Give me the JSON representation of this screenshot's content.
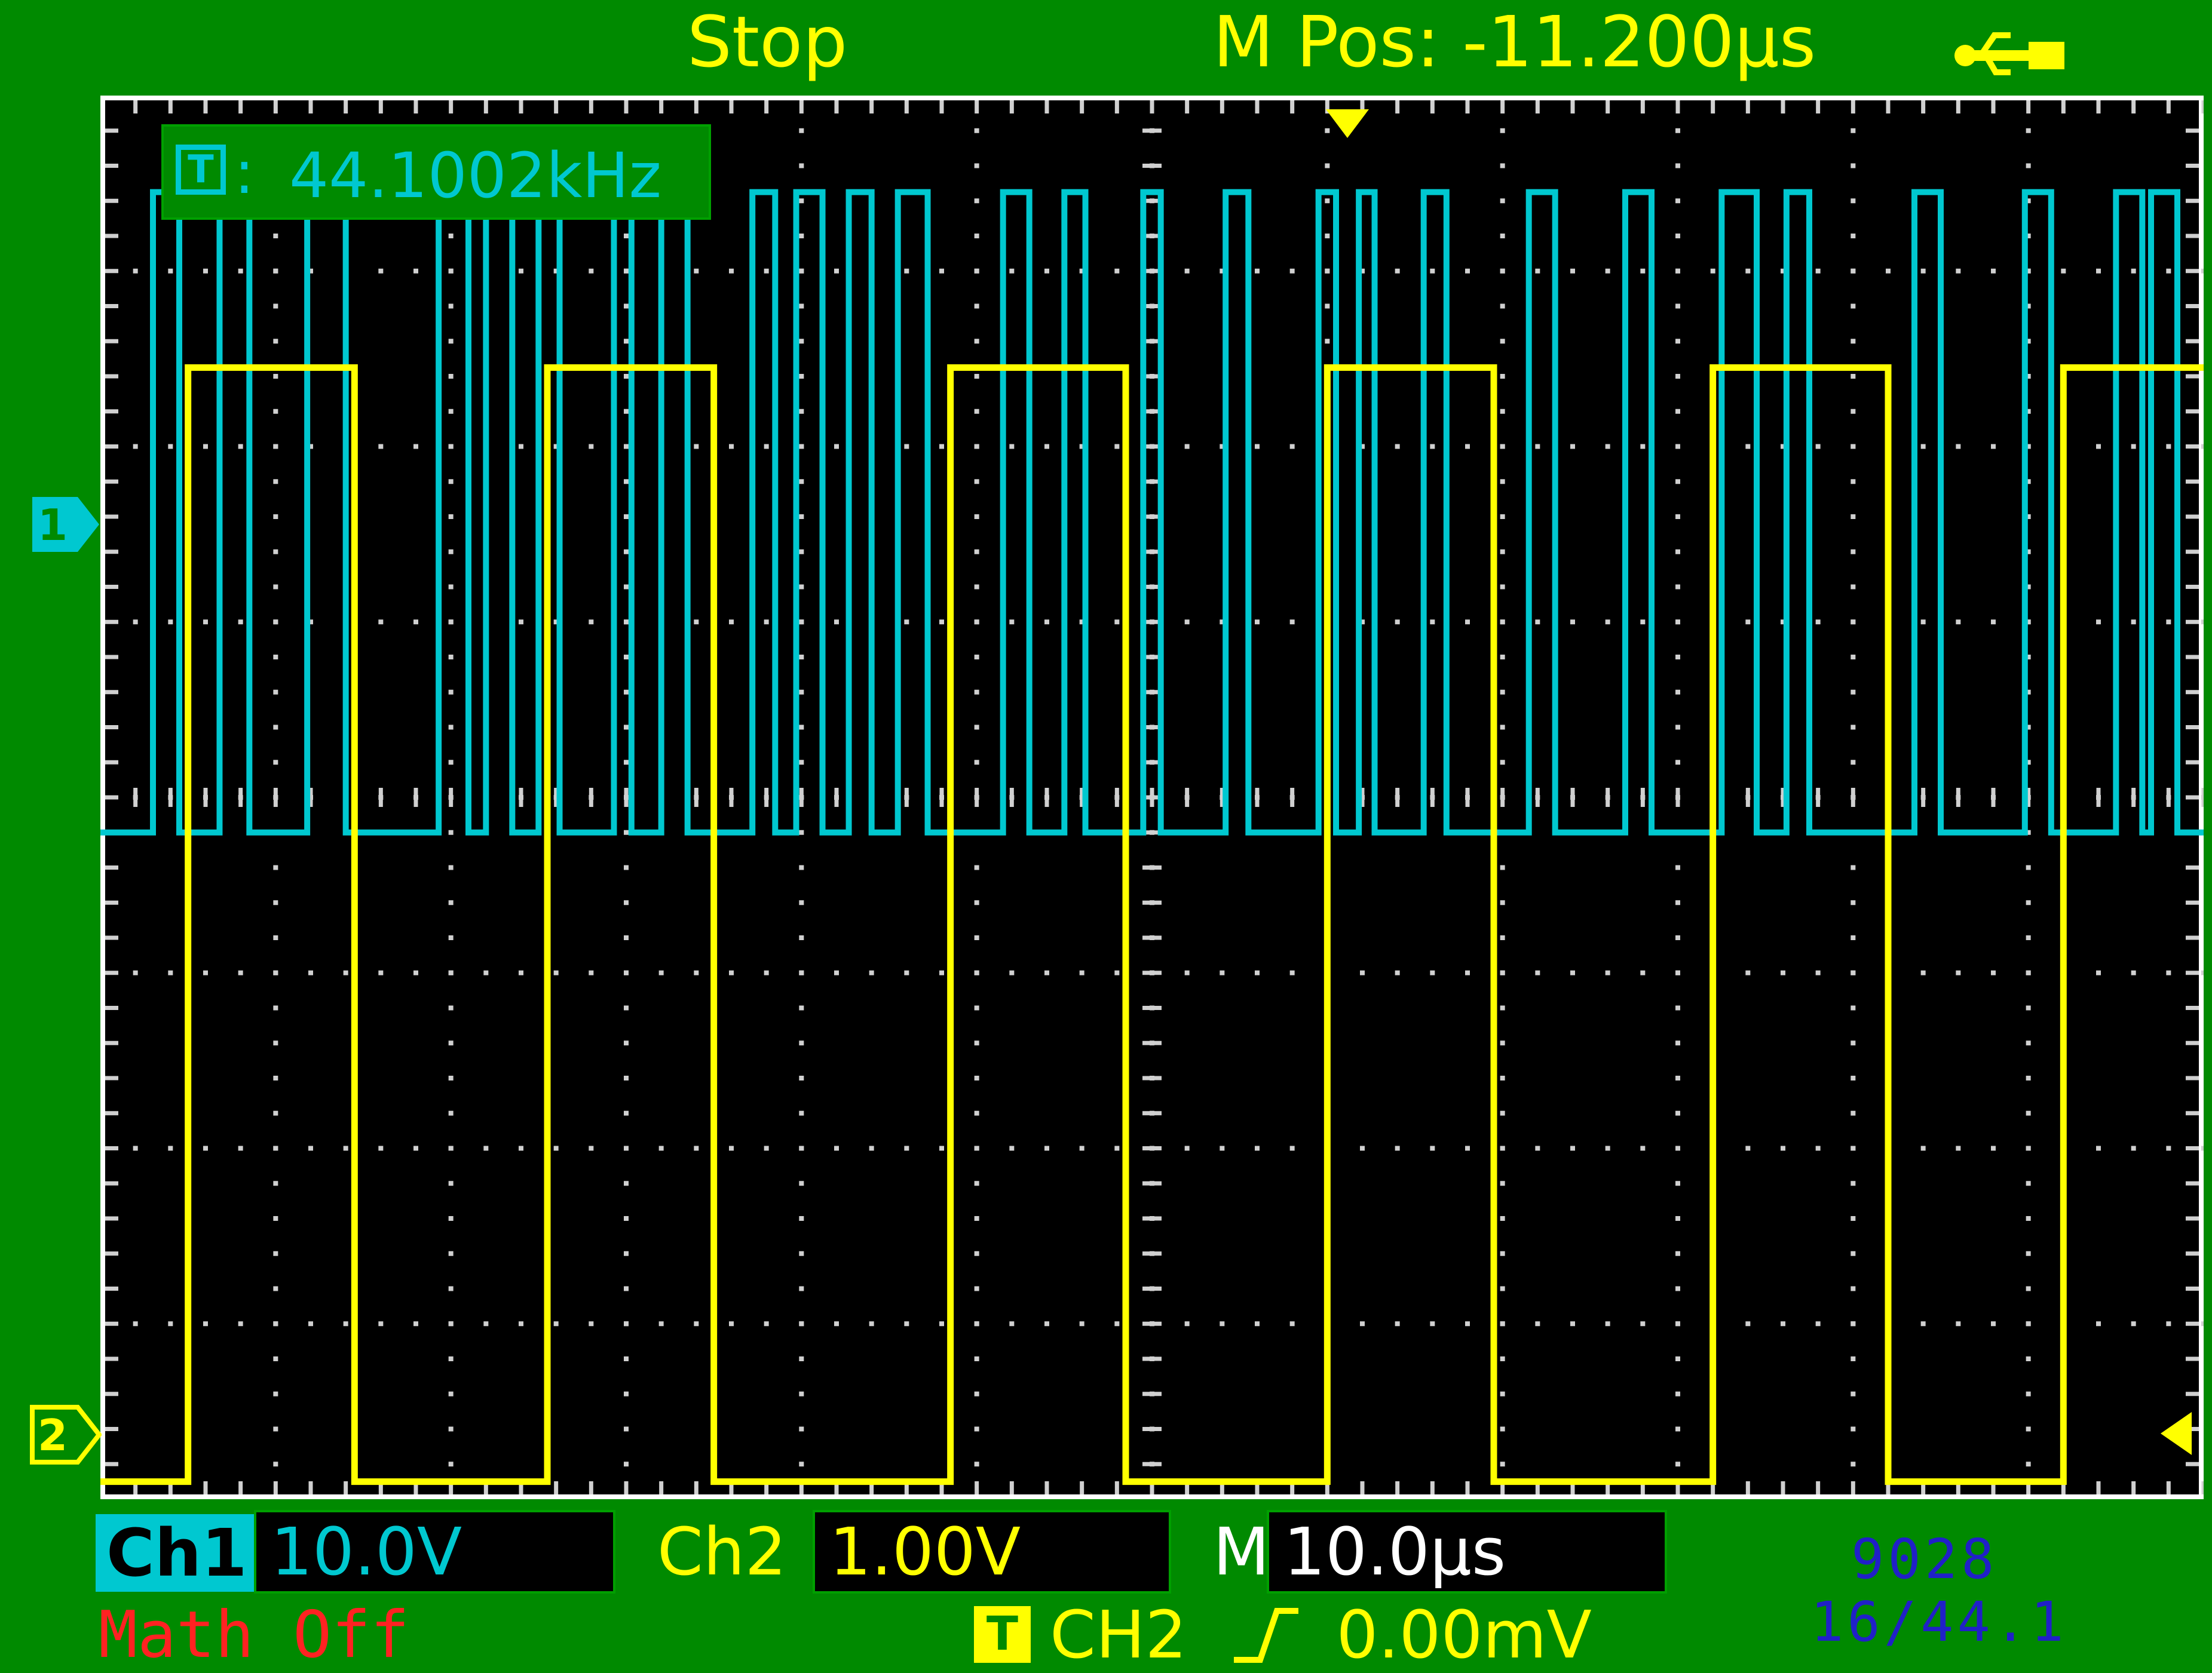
{
  "top_bar": {
    "status": "Stop",
    "m_pos": "M Pos: -11.200µs"
  },
  "measurement": {
    "freq_icon": "T",
    "separator": ":",
    "freq_value": "44.1002kHz"
  },
  "markers": {
    "ch1": "1",
    "ch2": "2"
  },
  "channels": [
    {
      "label": "Ch1",
      "volts_div": "10.0V",
      "color": "#00c8d0"
    },
    {
      "label": "Ch2",
      "volts_div": "1.00V",
      "color": "#ffff00"
    }
  ],
  "timebase": {
    "label": "M",
    "time_div": "10.0µs"
  },
  "math": {
    "status": "Math Off"
  },
  "trigger": {
    "icon": "T",
    "source": "CH2",
    "slope": "rising-edge-icon",
    "level": "0.00mV"
  },
  "annotation": {
    "line1": "9028",
    "line2": "16/44.1"
  },
  "colors": {
    "background": "#008a00",
    "screen": "#000000",
    "ch1": "#00c8d0",
    "ch2": "#ffff00",
    "math": "#ff2222",
    "annotation": "#2020c8"
  },
  "icons": {
    "usb": "usb-icon",
    "ch1_ground_marker": "ch1-ground-marker-icon",
    "ch2_ground_marker": "ch2-ground-marker-icon",
    "trigger_level_marker": "trigger-level-marker-icon",
    "trigger_position_marker": "trigger-position-marker-icon"
  },
  "waveform": {
    "grid": {
      "h_divisions": 12,
      "v_divisions": 8
    },
    "ch2_edge_times_div": [
      0.5,
      1.45,
      2.55,
      3.5,
      4.85,
      5.85,
      7.0,
      7.95,
      9.2,
      10.2,
      11.2,
      12.2
    ],
    "ch2_levels_div": {
      "high": 6.45,
      "low": 0.1
    },
    "ch1_levels_div": {
      "high": 7.45,
      "low": 3.8
    },
    "ch1_pulse_edges_div": [
      0.3,
      0.45,
      0.68,
      0.85,
      1.18,
      1.4,
      1.93,
      2.1,
      2.2,
      2.35,
      2.5,
      2.62,
      2.93,
      3.03,
      3.2,
      3.35,
      3.72,
      3.85,
      3.97,
      4.12,
      4.27,
      4.4,
      4.55,
      4.72,
      5.15,
      5.3,
      5.5,
      5.62,
      5.95,
      6.05,
      6.42,
      6.55,
      6.95,
      7.05,
      7.18,
      7.27,
      7.55,
      7.68,
      8.15,
      8.3,
      8.7,
      8.85,
      9.25,
      9.45,
      9.62,
      9.75,
      10.35,
      10.5,
      10.98,
      11.13,
      11.5,
      11.65,
      11.7,
      11.85,
      12.05,
      12.2
    ]
  }
}
